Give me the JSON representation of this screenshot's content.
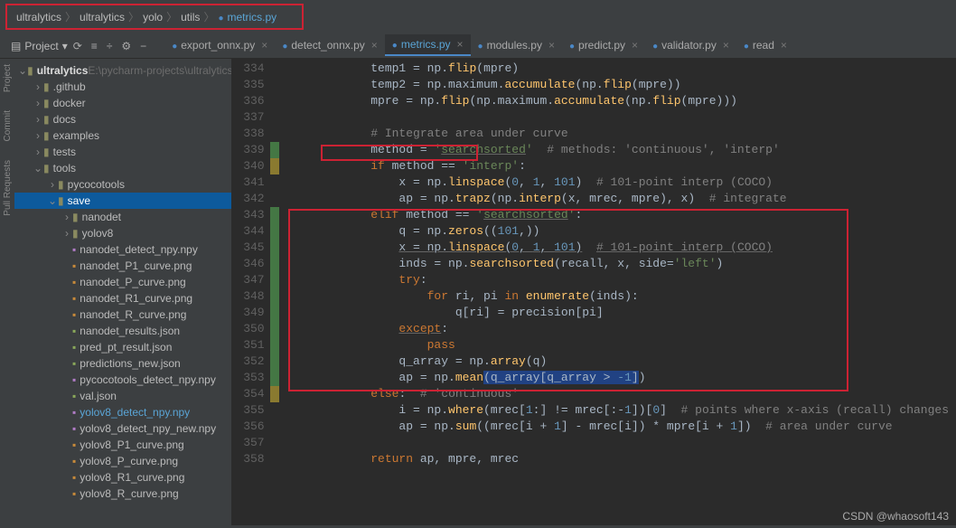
{
  "breadcrumb": [
    "ultralytics",
    "ultralytics",
    "yolo",
    "utils",
    "metrics.py"
  ],
  "project_label": "Project",
  "toolbar_icons": [
    "⟳",
    "≡",
    "÷",
    "⚙",
    "−"
  ],
  "vtools": [
    {
      "name": "project",
      "label": "Project"
    },
    {
      "name": "commit",
      "label": "Commit"
    },
    {
      "name": "pull",
      "label": "Pull Requests"
    }
  ],
  "tabs": [
    {
      "label": "export_onnx.py",
      "active": false
    },
    {
      "label": "detect_onnx.py",
      "active": false
    },
    {
      "label": "metrics.py",
      "active": true
    },
    {
      "label": "modules.py",
      "active": false
    },
    {
      "label": "predict.py",
      "active": false
    },
    {
      "label": "validator.py",
      "active": false
    },
    {
      "label": "read",
      "active": false
    }
  ],
  "tree": {
    "root": {
      "name": "ultralytics",
      "path": "E:\\pycharm-projects\\ultralytics"
    },
    "items": [
      {
        "d": 1,
        "folder": true,
        "open": false,
        "name": ".github"
      },
      {
        "d": 1,
        "folder": true,
        "open": false,
        "name": "docker"
      },
      {
        "d": 1,
        "folder": true,
        "open": false,
        "name": "docs"
      },
      {
        "d": 1,
        "folder": true,
        "open": false,
        "name": "examples"
      },
      {
        "d": 1,
        "folder": true,
        "open": false,
        "name": "tests"
      },
      {
        "d": 1,
        "folder": true,
        "open": true,
        "name": "tools"
      },
      {
        "d": 2,
        "folder": true,
        "open": false,
        "name": "pycocotools"
      },
      {
        "d": 2,
        "folder": true,
        "open": true,
        "name": "save",
        "selected": true
      },
      {
        "d": 3,
        "folder": true,
        "open": false,
        "name": "nanodet"
      },
      {
        "d": 3,
        "folder": true,
        "open": false,
        "name": "yolov8"
      },
      {
        "d": 3,
        "folder": false,
        "name": "nanodet_detect_npy.npy",
        "ico": "np"
      },
      {
        "d": 3,
        "folder": false,
        "name": "nanodet_P1_curve.png",
        "ico": "img"
      },
      {
        "d": 3,
        "folder": false,
        "name": "nanodet_P_curve.png",
        "ico": "img"
      },
      {
        "d": 3,
        "folder": false,
        "name": "nanodet_R1_curve.png",
        "ico": "img"
      },
      {
        "d": 3,
        "folder": false,
        "name": "nanodet_R_curve.png",
        "ico": "img"
      },
      {
        "d": 3,
        "folder": false,
        "name": "nanodet_results.json",
        "ico": "js"
      },
      {
        "d": 3,
        "folder": false,
        "name": "pred_pt_result.json",
        "ico": "js"
      },
      {
        "d": 3,
        "folder": false,
        "name": "predictions_new.json",
        "ico": "js"
      },
      {
        "d": 3,
        "folder": false,
        "name": "pycocotools_detect_npy.npy",
        "ico": "np"
      },
      {
        "d": 3,
        "folder": false,
        "name": "val.json",
        "ico": "js"
      },
      {
        "d": 3,
        "folder": false,
        "name": "yolov8_detect_npy.npy",
        "ico": "np",
        "hl": true
      },
      {
        "d": 3,
        "folder": false,
        "name": "yolov8_detect_npy_new.npy",
        "ico": "np"
      },
      {
        "d": 3,
        "folder": false,
        "name": "yolov8_P1_curve.png",
        "ico": "img"
      },
      {
        "d": 3,
        "folder": false,
        "name": "yolov8_P_curve.png",
        "ico": "img"
      },
      {
        "d": 3,
        "folder": false,
        "name": "yolov8_R1_curve.png",
        "ico": "img"
      },
      {
        "d": 3,
        "folder": false,
        "name": "yolov8_R_curve.png",
        "ico": "img"
      }
    ]
  },
  "code": {
    "start": 334,
    "lines": [
      {
        "n": 334,
        "m": "",
        "html": "            <span class='id'>temp1 = np.</span><span class='fn'>flip</span><span class='id'>(mpre)</span>"
      },
      {
        "n": 335,
        "m": "",
        "html": "            <span class='id'>temp2 = np.maximum.</span><span class='fn'>accumulate</span><span class='id'>(np.</span><span class='fn'>flip</span><span class='id'>(mpre))</span>"
      },
      {
        "n": 336,
        "m": "",
        "html": "            <span class='id'>mpre = np.</span><span class='fn'>flip</span><span class='id'>(np.maximum.</span><span class='fn'>accumulate</span><span class='id'>(np.</span><span class='fn'>flip</span><span class='id'>(mpre)))</span>"
      },
      {
        "n": 337,
        "m": "",
        "html": ""
      },
      {
        "n": 338,
        "m": "",
        "html": "            <span class='cm'># Integrate area under curve</span>"
      },
      {
        "n": 339,
        "m": "g",
        "html": "            <span class='id'>method = </span><span class='str'>'<span class='ul'>searchsorted</span>'</span>  <span class='cm'># methods: 'continuous', 'interp'</span>"
      },
      {
        "n": 340,
        "m": "y",
        "html": "            <span class='kw'>if </span><span class='id'>method == </span><span class='str'>'interp'</span><span class='id'>:</span>"
      },
      {
        "n": 341,
        "m": "",
        "html": "                <span class='id'>x = np.</span><span class='fn'>linspace</span><span class='id'>(</span><span class='num'>0</span><span class='id'>, </span><span class='num'>1</span><span class='id'>, </span><span class='num'>101</span><span class='id'>)</span>  <span class='cm'># 101-point interp (COCO)</span>"
      },
      {
        "n": 342,
        "m": "",
        "html": "                <span class='id'>ap = np.</span><span class='fn'>trapz</span><span class='id'>(np.</span><span class='fn'>interp</span><span class='id'>(x, mrec, mpre), x)</span>  <span class='cm'># integrate</span>"
      },
      {
        "n": 343,
        "m": "g",
        "html": "            <span class='kw'>elif </span><span class='id'>method == </span><span class='str'>'<span class='ul'>searchsorted</span>'</span><span class='id'>:</span>"
      },
      {
        "n": 344,
        "m": "g",
        "html": "                <span class='id'>q = np.</span><span class='fn'>zeros</span><span class='id'>((</span><span class='num'>101</span><span class='id'>,))</span>"
      },
      {
        "n": 345,
        "m": "g",
        "html": "                <span class='id ul'>x = np.</span><span class='fn ul'>linspace</span><span class='id ul'>(</span><span class='num ul'>0</span><span class='id ul'>, </span><span class='num ul'>1</span><span class='id ul'>, </span><span class='num ul'>101</span><span class='id ul'>)</span>  <span class='cm ul'># 101-point interp (COCO)</span>"
      },
      {
        "n": 346,
        "m": "g",
        "html": "                <span class='id'>inds = np.</span><span class='fn'>searchsorted</span><span class='id'>(recall, x, </span><span class='id'>side=</span><span class='str'>'left'</span><span class='id'>)</span>"
      },
      {
        "n": 347,
        "m": "g",
        "html": "                <span class='kw'>try</span><span class='id'>:</span>"
      },
      {
        "n": 348,
        "m": "g",
        "html": "                    <span class='kw'>for </span><span class='id'>ri, pi </span><span class='kw'>in </span><span class='fn'>enumerate</span><span class='id'>(inds):</span>"
      },
      {
        "n": 349,
        "m": "g",
        "html": "                        <span class='id'>q[ri] = precision[pi]</span>"
      },
      {
        "n": 350,
        "m": "g",
        "html": "                <span class='kw ul'>except</span><span class='id'>:</span>"
      },
      {
        "n": 351,
        "m": "g",
        "html": "                    <span class='kw'>pass</span>"
      },
      {
        "n": 352,
        "m": "g",
        "html": "                <span class='id'>q_array = np.</span><span class='fn'>array</span><span class='id'>(q)</span>"
      },
      {
        "n": 353,
        "m": "g",
        "html": "                <span class='id'>ap = np.</span><span class='fn'>mean</span><span style='background:#214283'><span class='id'>(q_array[q_array &gt; </span><span class='num'>-1</span><span class='id'>]</span></span><span class='id'>)</span>"
      },
      {
        "n": 354,
        "m": "y",
        "html": "            <span class='kw'>else</span><span class='id'>:</span>  <span class='cm'># 'continuous'</span>"
      },
      {
        "n": 355,
        "m": "",
        "html": "                <span class='id'>i = np.</span><span class='fn'>where</span><span class='id'>(mrec[</span><span class='num'>1</span><span class='id'>:] != mrec[:-</span><span class='num'>1</span><span class='id'>])[</span><span class='num'>0</span><span class='id'>]</span>  <span class='cm'># points where x-axis (recall) changes</span>"
      },
      {
        "n": 356,
        "m": "",
        "html": "                <span class='id'>ap = np.</span><span class='fn'>sum</span><span class='id'>((mrec[i + </span><span class='num'>1</span><span class='id'>] - mrec[i]) * mpre[i + </span><span class='num'>1</span><span class='id'>])</span>  <span class='cm'># area under curve</span>"
      },
      {
        "n": 357,
        "m": "",
        "html": ""
      },
      {
        "n": 358,
        "m": "",
        "html": "            <span class='kw'>return </span><span class='id'>ap, mpre, mrec</span>"
      }
    ]
  },
  "watermark": "CSDN @whaosoft143"
}
